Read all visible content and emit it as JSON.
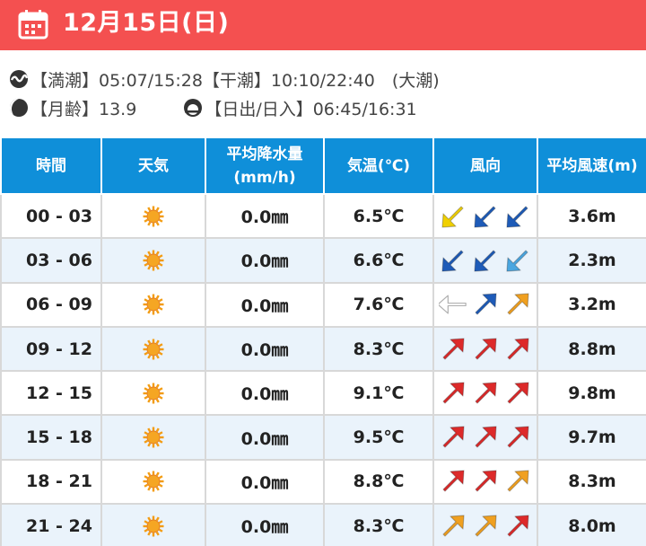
{
  "header": {
    "date": "12月15日(日)",
    "icon": "calendar-icon",
    "bg_color": "#f45050"
  },
  "info": {
    "tide_icon": "tide-wave-icon",
    "tide_text": "【満潮】05:07/15:28【干潮】10:10/22:40　(大潮)",
    "moon_icon": "moon-phase-icon",
    "moon_text": "【月齢】13.9",
    "sun_icon": "sunrise-sunset-icon",
    "sun_text": "【日出/日入】06:45/16:31"
  },
  "table": {
    "header_color": "#0f8fd9",
    "columns": [
      "時間",
      "天気",
      "平均降水量",
      "(mm/h)",
      "気温(℃)",
      "風向",
      "平均風速(m)"
    ],
    "rows": [
      {
        "time": "00 - 03",
        "weather": "sunny-icon",
        "precip": "0.0㎜",
        "temp": "6.5℃",
        "wind_dirs": [
          {
            "dir": "southwest",
            "color": "#f0d000"
          },
          {
            "dir": "southwest",
            "color": "#1e5bb8"
          },
          {
            "dir": "southwest",
            "color": "#1e5bb8"
          }
        ],
        "wind_speed": "3.6m"
      },
      {
        "time": "03 - 06",
        "weather": "sunny-icon",
        "precip": "0.0㎜",
        "temp": "6.6℃",
        "wind_dirs": [
          {
            "dir": "southwest",
            "color": "#1e5bb8"
          },
          {
            "dir": "southwest",
            "color": "#1e5bb8"
          },
          {
            "dir": "southwest",
            "color": "#4aa6e0"
          }
        ],
        "wind_speed": "2.3m"
      },
      {
        "time": "06 - 09",
        "weather": "sunny-icon",
        "precip": "0.0㎜",
        "temp": "7.6℃",
        "wind_dirs": [
          {
            "dir": "west",
            "color": "#ffffff"
          },
          {
            "dir": "northeast",
            "color": "#1e5bb8"
          },
          {
            "dir": "northeast",
            "color": "#f0a020"
          }
        ],
        "wind_speed": "3.2m"
      },
      {
        "time": "09 - 12",
        "weather": "sunny-icon",
        "precip": "0.0㎜",
        "temp": "8.3℃",
        "wind_dirs": [
          {
            "dir": "northeast",
            "color": "#dd2a2a"
          },
          {
            "dir": "northeast",
            "color": "#dd2a2a"
          },
          {
            "dir": "northeast",
            "color": "#dd2a2a"
          }
        ],
        "wind_speed": "8.8m"
      },
      {
        "time": "12 - 15",
        "weather": "sunny-icon",
        "precip": "0.0㎜",
        "temp": "9.1℃",
        "wind_dirs": [
          {
            "dir": "northeast",
            "color": "#dd2a2a"
          },
          {
            "dir": "northeast",
            "color": "#dd2a2a"
          },
          {
            "dir": "northeast",
            "color": "#dd2a2a"
          }
        ],
        "wind_speed": "9.8m"
      },
      {
        "time": "15 - 18",
        "weather": "sunny-icon",
        "precip": "0.0㎜",
        "temp": "9.5℃",
        "wind_dirs": [
          {
            "dir": "northeast",
            "color": "#dd2a2a"
          },
          {
            "dir": "northeast",
            "color": "#dd2a2a"
          },
          {
            "dir": "northeast",
            "color": "#dd2a2a"
          }
        ],
        "wind_speed": "9.7m"
      },
      {
        "time": "18 - 21",
        "weather": "sunny-icon",
        "precip": "0.0㎜",
        "temp": "8.8℃",
        "wind_dirs": [
          {
            "dir": "northeast",
            "color": "#dd2a2a"
          },
          {
            "dir": "northeast",
            "color": "#dd2a2a"
          },
          {
            "dir": "northeast",
            "color": "#f0a020"
          }
        ],
        "wind_speed": "8.3m"
      },
      {
        "time": "21 - 24",
        "weather": "sunny-icon",
        "precip": "0.0㎜",
        "temp": "8.3℃",
        "wind_dirs": [
          {
            "dir": "northeast",
            "color": "#f0a020"
          },
          {
            "dir": "northeast",
            "color": "#f0a020"
          },
          {
            "dir": "northeast",
            "color": "#dd2a2a"
          }
        ],
        "wind_speed": "8.0m"
      }
    ]
  }
}
